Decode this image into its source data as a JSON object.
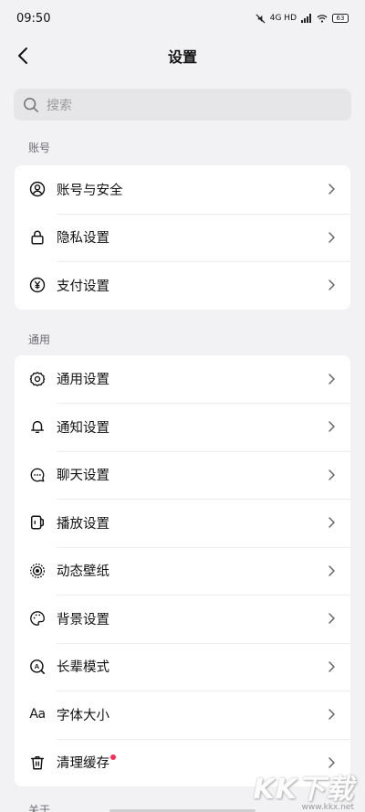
{
  "status_bar": {
    "time": "09:50",
    "network": "4G HD",
    "battery": "63"
  },
  "header": {
    "title": "设置"
  },
  "search": {
    "placeholder": "搜索"
  },
  "sections": [
    {
      "label": "账号",
      "items": [
        {
          "label": "账号与安全",
          "icon": "user-circle-icon"
        },
        {
          "label": "隐私设置",
          "icon": "lock-icon"
        },
        {
          "label": "支付设置",
          "icon": "yen-circle-icon"
        }
      ]
    },
    {
      "label": "通用",
      "items": [
        {
          "label": "通用设置",
          "icon": "gear-icon"
        },
        {
          "label": "通知设置",
          "icon": "bell-icon"
        },
        {
          "label": "聊天设置",
          "icon": "chat-bubble-icon"
        },
        {
          "label": "播放设置",
          "icon": "play-panel-icon"
        },
        {
          "label": "动态壁纸",
          "icon": "dynamic-wallpaper-icon"
        },
        {
          "label": "背景设置",
          "icon": "palette-icon"
        },
        {
          "label": "长辈模式",
          "icon": "elder-mode-icon"
        },
        {
          "label": "字体大小",
          "icon": "font-size-icon",
          "icon_text": "Aa"
        },
        {
          "label": "清理缓存",
          "icon": "trash-icon",
          "badge": true
        }
      ]
    }
  ],
  "next_section_partial": "关于",
  "watermark": {
    "big": "KK下载",
    "small": "www.kkx.net"
  }
}
